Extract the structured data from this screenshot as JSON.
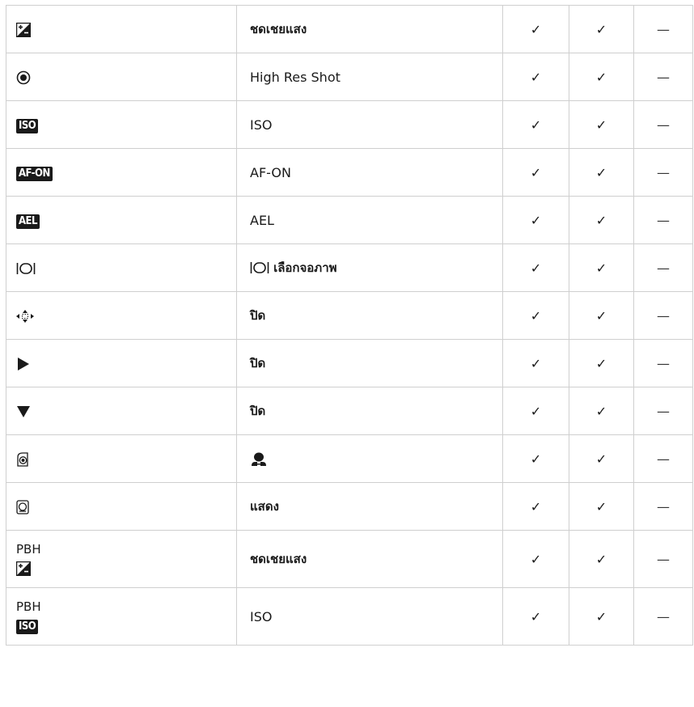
{
  "rows": [
    {
      "icon": "exposure-comp-icon",
      "value": "ชดเชยแสง"
    },
    {
      "icon": "high-res-shot-icon",
      "value": "High Res Shot"
    },
    {
      "icon": "iso-icon",
      "icon_text": "ISO",
      "value": "ISO"
    },
    {
      "icon": "af-on-icon",
      "icon_text": "AF-ON",
      "value": "AF-ON"
    },
    {
      "icon": "ael-icon",
      "icon_text": "AEL",
      "value": "AEL"
    },
    {
      "icon": "display-select-icon",
      "value": "เลือกจอภาพ"
    },
    {
      "icon": "direction-pad-icon",
      "value": "ปิด"
    },
    {
      "icon": "right-arrow-icon",
      "value": "ปิด"
    },
    {
      "icon": "down-arrow-icon",
      "value": "ปิด"
    },
    {
      "icon": "lens-front-dial-icon",
      "value": "",
      "value_icon": "face-priority-icon"
    },
    {
      "icon": "lens-ring-icon",
      "value": "แสดง"
    },
    {
      "prefix": "PBH",
      "icon": "exposure-comp-icon",
      "value": "ชดเชยแสง"
    },
    {
      "prefix": "PBH",
      "icon": "iso-icon",
      "icon_text": "ISO",
      "value": "ISO"
    }
  ],
  "check": "✓",
  "dash": "—"
}
